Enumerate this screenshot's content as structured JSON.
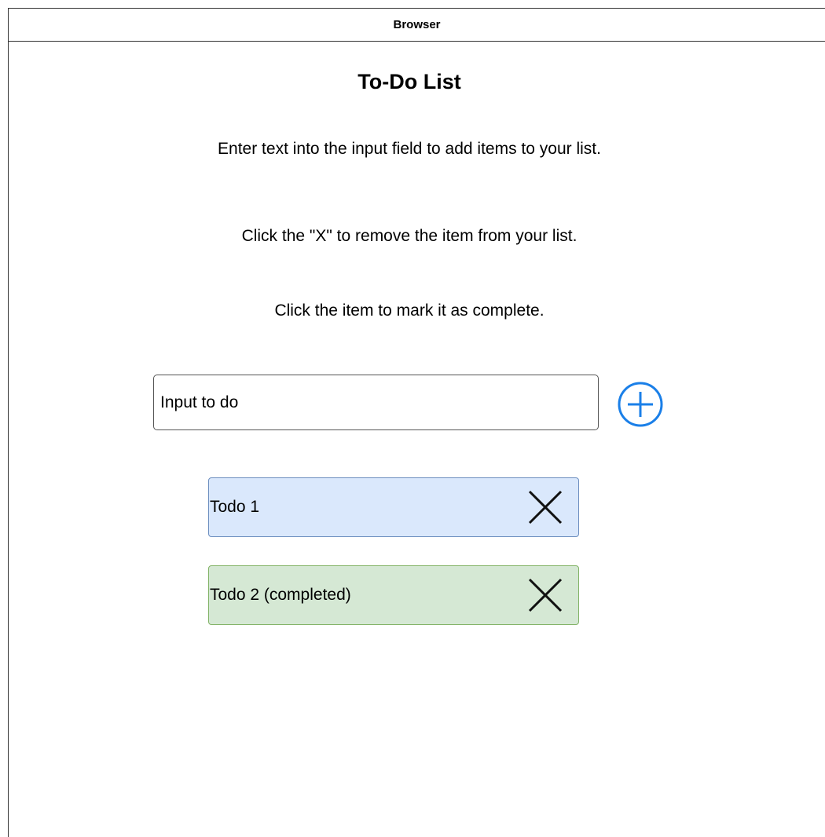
{
  "window": {
    "title": "Browser"
  },
  "page": {
    "title": "To-Do List",
    "instructions": [
      "Enter text into the input field to add items to your list.",
      "Click the \"X\" to remove the item from your list.",
      "Click the item to mark it as complete."
    ]
  },
  "input": {
    "placeholder": "Input to do"
  },
  "add_button": {
    "icon": "plus-circle-icon",
    "color": "#1a7fe8"
  },
  "todos": [
    {
      "label": "Todo 1",
      "completed": false,
      "bg": "#dae8fc",
      "border": "#6c8ebf"
    },
    {
      "label": "Todo 2 (completed)",
      "completed": true,
      "bg": "#d5e8d4",
      "border": "#82b366"
    }
  ],
  "remove_icon": "close-icon"
}
